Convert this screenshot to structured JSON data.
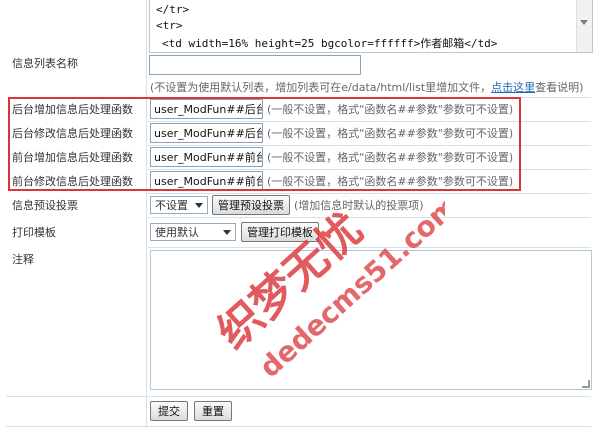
{
  "code_box": {
    "lines": [
      "</tr>",
      "<tr>",
      "  <td width=16% height=25 bgcolor=ffffff>作者邮箱</td>"
    ]
  },
  "rows": {
    "list_name": {
      "label": "信息列表名称",
      "note": "(不设置为使用默认列表，增加列表可在e/data/html/list里增加文件，",
      "link": "点击这里",
      "note_tail": "查看说明)"
    },
    "after_add_bg": {
      "label": "后台增加信息后处理函数",
      "value": "user_ModFun##后台增",
      "note": "(一般不设置，格式\"函数名##参数\"参数可不设置)"
    },
    "after_edit_bg": {
      "label": "后台修改信息后处理函数",
      "value": "user_ModFun##后台修",
      "note": "(一般不设置，格式\"函数名##参数\"参数可不设置)"
    },
    "after_add_fg": {
      "label": "前台增加信息后处理函数",
      "value": "user_ModFun##前台增",
      "note": "(一般不设置，格式\"函数名##参数\"参数可不设置)"
    },
    "after_edit_fg": {
      "label": "前台修改信息后处理函数",
      "value": "user_ModFun##前台修",
      "note": "(一般不设置，格式\"函数名##参数\"参数可不设置)"
    },
    "vote": {
      "label": "信息预设投票",
      "select": "不设置",
      "button": "管理预设投票",
      "note": "(增加信息时默认的投票项)"
    },
    "print": {
      "label": "打印模板",
      "select": "使用默认",
      "button": "管理打印模板"
    },
    "remark": {
      "label": "注释"
    }
  },
  "buttons": {
    "submit": "提交",
    "reset": "重置"
  },
  "watermark": {
    "line1": "织梦无忧",
    "line2": "dedecms51.com"
  },
  "colors": {
    "highlight": "#d9363b",
    "border": "#cfe3ef",
    "watermark": "#d9363b"
  }
}
